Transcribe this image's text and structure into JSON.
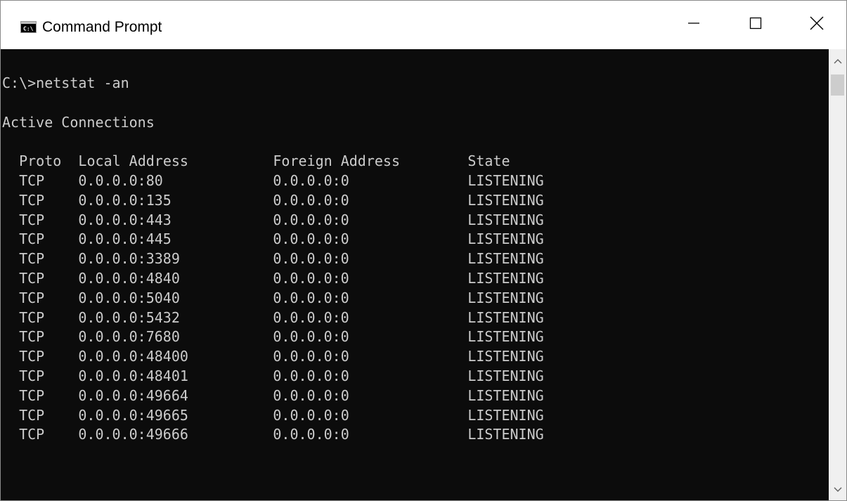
{
  "window": {
    "title": "Command Prompt",
    "icon": "console-app-icon",
    "controls": {
      "minimize_icon": "minimize-icon",
      "maximize_icon": "maximize-icon",
      "close_icon": "close-icon"
    }
  },
  "console": {
    "prompt": "C:\\>netstat -an",
    "heading": "Active Connections",
    "columns": [
      "Proto",
      "Local Address",
      "Foreign Address",
      "State"
    ],
    "rows": [
      [
        "TCP",
        "0.0.0.0:80",
        "0.0.0.0:0",
        "LISTENING"
      ],
      [
        "TCP",
        "0.0.0.0:135",
        "0.0.0.0:0",
        "LISTENING"
      ],
      [
        "TCP",
        "0.0.0.0:443",
        "0.0.0.0:0",
        "LISTENING"
      ],
      [
        "TCP",
        "0.0.0.0:445",
        "0.0.0.0:0",
        "LISTENING"
      ],
      [
        "TCP",
        "0.0.0.0:3389",
        "0.0.0.0:0",
        "LISTENING"
      ],
      [
        "TCP",
        "0.0.0.0:4840",
        "0.0.0.0:0",
        "LISTENING"
      ],
      [
        "TCP",
        "0.0.0.0:5040",
        "0.0.0.0:0",
        "LISTENING"
      ],
      [
        "TCP",
        "0.0.0.0:5432",
        "0.0.0.0:0",
        "LISTENING"
      ],
      [
        "TCP",
        "0.0.0.0:7680",
        "0.0.0.0:0",
        "LISTENING"
      ],
      [
        "TCP",
        "0.0.0.0:48400",
        "0.0.0.0:0",
        "LISTENING"
      ],
      [
        "TCP",
        "0.0.0.0:48401",
        "0.0.0.0:0",
        "LISTENING"
      ],
      [
        "TCP",
        "0.0.0.0:49664",
        "0.0.0.0:0",
        "LISTENING"
      ],
      [
        "TCP",
        "0.0.0.0:49665",
        "0.0.0.0:0",
        "LISTENING"
      ],
      [
        "TCP",
        "0.0.0.0:49666",
        "0.0.0.0:0",
        "LISTENING"
      ]
    ]
  },
  "colors": {
    "console_background": "#0c0c0c",
    "console_text": "#cccccc",
    "titlebar_background": "#ffffff"
  }
}
